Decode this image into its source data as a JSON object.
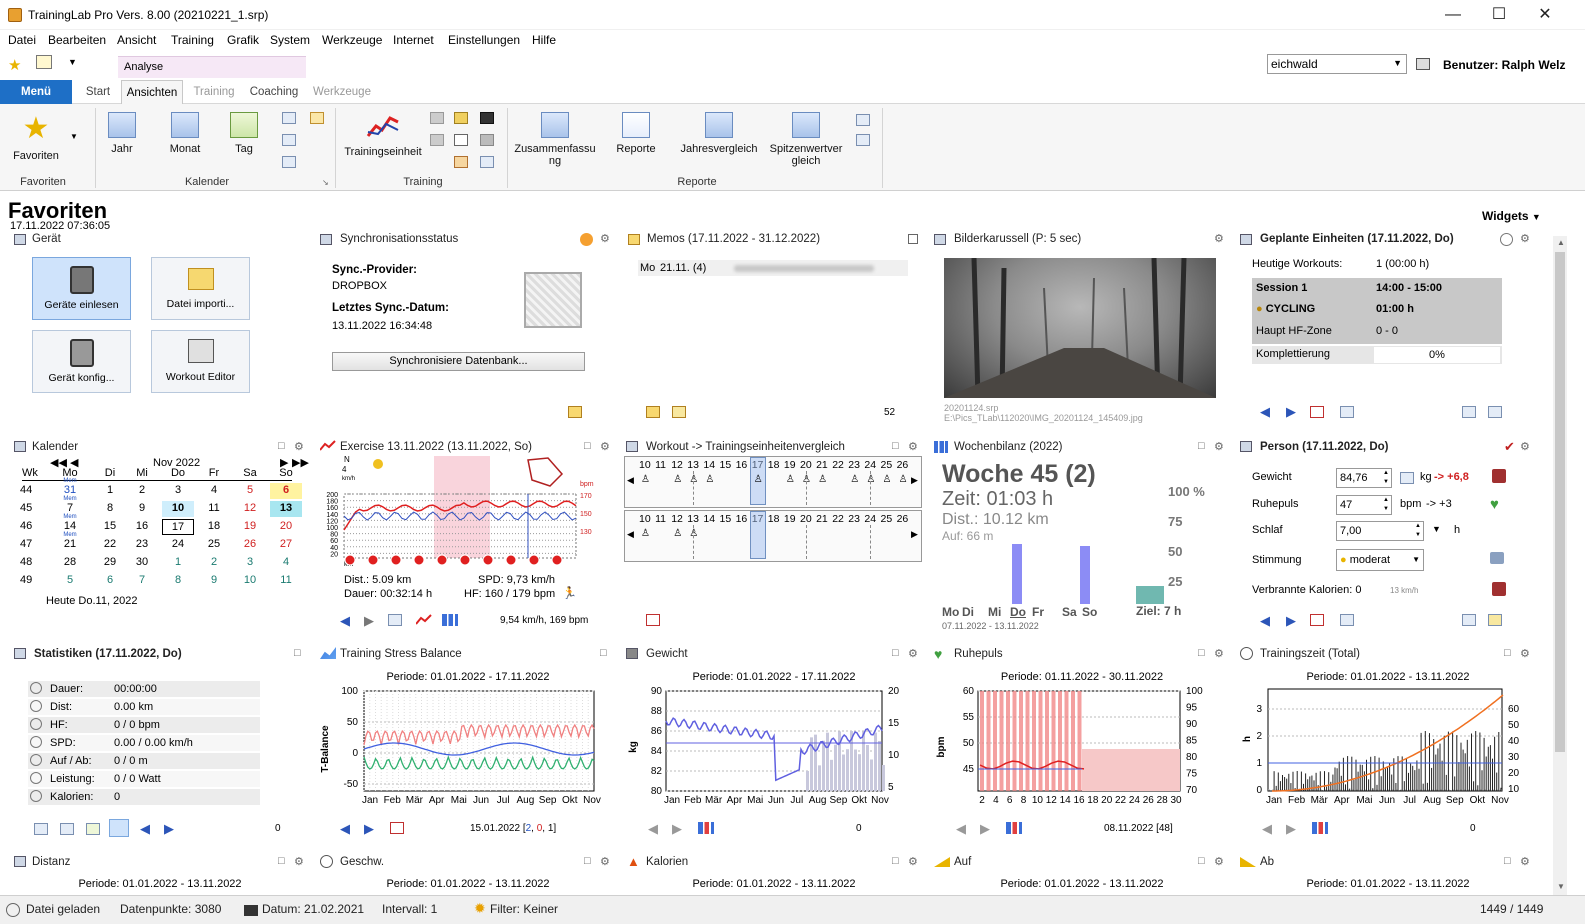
{
  "window": {
    "title": "TrainingLab Pro Vers. 8.00 (20210221_1.srp)"
  },
  "menu": [
    "Datei",
    "Bearbeiten",
    "Ansicht",
    "Training",
    "Grafik",
    "System",
    "Werkzeuge",
    "Internet",
    "Einstellungen",
    "Hilfe"
  ],
  "context_tab": "Analyse",
  "user_select": "eichwald",
  "user_label": "Benutzer: Ralph Welz",
  "tabs": {
    "menu": "Menü",
    "start": "Start",
    "ansichten": "Ansichten",
    "training": "Training",
    "coaching": "Coaching",
    "werkzeuge": "Werkzeuge"
  },
  "ribbon": {
    "favoriten": "Favoriten",
    "jahr": "Jahr",
    "monat": "Monat",
    "tag": "Tag",
    "trainingseinheit": "Trainingseinheit",
    "zusammenfassung": "Zusammenfassu ng",
    "reporte": "Reporte",
    "jahresvergleich": "Jahresvergleich",
    "spitzenwertvergleich": "Spitzenwertver gleich",
    "grp_favoriten": "Favoriten",
    "grp_kalender": "Kalender",
    "grp_training": "Training",
    "grp_reporte": "Reporte"
  },
  "page": {
    "title": "Favoriten",
    "datetime": "17.11.2022 07:36:05",
    "widgets": "Widgets"
  },
  "geraet": {
    "title": "Gerät",
    "b1": "Geräte einlesen",
    "b2": "Datei importi...",
    "b3": "Gerät konfig...",
    "b4": "Workout Editor"
  },
  "sync": {
    "title": "Synchronisationsstatus",
    "provider_label": "Sync.-Provider:",
    "provider": "DROPBOX",
    "last_label": "Letztes Sync.-Datum:",
    "last": "13.11.2022 16:34:48",
    "button": "Synchronisiere Datenbank..."
  },
  "memos": {
    "title": "Memos (17.11.2022 - 31.12.2022)",
    "row_day": "Mo",
    "row_date": "21.11. (4)",
    "count": "52"
  },
  "bilder": {
    "title": "Bilderkarussell (P: 5 sec)",
    "caption1": "20201124.srp",
    "caption2": "E:\\Pics_TLab\\112020\\IMG_20201124_145409.jpg"
  },
  "geplant": {
    "title": "Geplante Einheiten (17.11.2022, Do)",
    "heutige_label": "Heutige Workouts:",
    "heutige": "1 (00:00 h)",
    "session": "Session 1",
    "session_time": "14:00 - 15:00",
    "sport": "CYCLING",
    "dur": "01:00 h",
    "zone_label": "Haupt HF-Zone",
    "zone": "0 - 0",
    "kompl_label": "Komplettierung",
    "kompl": "0%"
  },
  "kalender": {
    "title": "Kalender",
    "month": "Nov 2022",
    "wk": "Wk",
    "days": [
      "Mo",
      "Di",
      "Mi",
      "Do",
      "Fr",
      "Sa",
      "So"
    ],
    "rows": [
      [
        "44",
        "31",
        "1",
        "2",
        "3",
        "4",
        "5",
        "6"
      ],
      [
        "45",
        "7",
        "8",
        "9",
        "10",
        "11",
        "12",
        "13"
      ],
      [
        "46",
        "14",
        "15",
        "16",
        "17",
        "18",
        "19",
        "20"
      ],
      [
        "47",
        "21",
        "22",
        "23",
        "24",
        "25",
        "26",
        "27"
      ],
      [
        "48",
        "28",
        "29",
        "30",
        "1",
        "2",
        "3",
        "4"
      ],
      [
        "49",
        "5",
        "6",
        "7",
        "8",
        "9",
        "10",
        "11"
      ]
    ],
    "today": "Heute Do.11, 2022",
    "mem": "Mem"
  },
  "exercise": {
    "title": "Exercise 13.11.2022 (13.11.2022, So)",
    "dist": "Dist.: 5.09 km",
    "spd": "SPD: 9,73 km/h",
    "dauer": "Dauer: 00:32:14 h",
    "hf": "HF: 160 / 179 bpm",
    "foot": "9,54 km/h, 169 bpm",
    "yticks": [
      "200",
      "180",
      "160",
      "140",
      "120",
      "100",
      "80",
      "60",
      "40",
      "20"
    ],
    "r170": "170",
    "r150": "150",
    "r130": "130",
    "bpm": "bpm",
    "n": "N",
    "kmh": "4",
    "kmhunit": "km/h",
    "km": "km"
  },
  "workout": {
    "title": "Workout -> Trainingseinheitenvergleich",
    "nums": [
      "10",
      "11",
      "12",
      "13",
      "14",
      "15",
      "16",
      "17",
      "18",
      "19",
      "20",
      "21",
      "22",
      "23",
      "24",
      "25",
      "26"
    ]
  },
  "wochen": {
    "title": "Wochenbilanz (2022)",
    "woche": "Woche 45 (2)",
    "zeit": "Zeit: 01:03 h",
    "dist": "Dist.: 10.12 km",
    "auf": "Auf: 66 m",
    "pct": [
      "100 %",
      "75",
      "50",
      "25"
    ],
    "days": [
      "Mo",
      "Di",
      "Mi",
      "Do",
      "Fr",
      "Sa",
      "So"
    ],
    "ziel": "Ziel: 7 h",
    "range": "07.11.2022 - 13.11.2022"
  },
  "person": {
    "title": "Person (17.11.2022, Do)",
    "gewicht_label": "Gewicht",
    "gewicht": "84,76",
    "gewicht_unit": "kg",
    "gewicht_delta": "-> +6,8",
    "ruhe_label": "Ruhepuls",
    "ruhe": "47",
    "ruhe_unit": "bpm",
    "ruhe_delta": "-> +3",
    "schlaf_label": "Schlaf",
    "schlaf": "7,00",
    "schlaf_unit": "h",
    "stimmung_label": "Stimmung",
    "stimmung": "moderat",
    "kal_label": "Verbrannte Kalorien: 0",
    "kal_unit": "13 km/h"
  },
  "stats": {
    "title": "Statistiken (17.11.2022, Do)",
    "rows": [
      [
        "Dauer:",
        "00:00:00"
      ],
      [
        "Dist:",
        "0.00 km"
      ],
      [
        "HF:",
        "0 / 0 bpm"
      ],
      [
        "SPD:",
        "0.00 / 0.00 km/h"
      ],
      [
        "Auf / Ab:",
        "0 / 0 m"
      ],
      [
        "Leistung:",
        "0 / 0 Watt"
      ],
      [
        "Kalorien:",
        "0"
      ]
    ],
    "count": "0"
  },
  "tsb": {
    "title": "Training Stress Balance",
    "period": "Periode: 01.01.2022 - 17.11.2022",
    "ylabel": "T-Balance",
    "yticks": [
      "100",
      "50",
      "0",
      "-50"
    ],
    "months": [
      "Jan",
      "Feb",
      "Mär",
      "Apr",
      "Mai",
      "Jun",
      "Jul",
      "Aug",
      "Sep",
      "Okt",
      "Nov"
    ],
    "foot": "15.01.2022 [2, 0, 1]",
    "foot_a": "15.01.2022 [",
    "foot_b": "2",
    "foot_c": "0",
    "foot_d": "1",
    "foot_e": "]"
  },
  "gewicht": {
    "title": "Gewicht",
    "period": "Periode: 01.01.2022 - 17.11.2022",
    "ylabel": "kg",
    "yticks": [
      "90",
      "88",
      "86",
      "84",
      "82",
      "80"
    ],
    "y2": [
      "20",
      "15",
      "10",
      "5"
    ],
    "months": [
      "Jan",
      "Feb",
      "Mär",
      "Apr",
      "Mai",
      "Jun",
      "Jul",
      "Aug",
      "Sep",
      "Okt",
      "Nov"
    ],
    "count": "0"
  },
  "ruhepuls": {
    "title": "Ruhepuls",
    "period": "Periode: 01.11.2022 - 30.11.2022",
    "ylabel": "bpm",
    "yticks": [
      "60",
      "55",
      "50",
      "45"
    ],
    "y2": [
      "100",
      "95",
      "90",
      "85",
      "80",
      "75",
      "70"
    ],
    "xticks": [
      "2",
      "4",
      "6",
      "8",
      "10",
      "12",
      "14",
      "16",
      "18",
      "20",
      "22",
      "24",
      "26",
      "28",
      "30"
    ],
    "foot": "08.11.2022 [48]"
  },
  "tzeit": {
    "title": "Trainingszeit (Total)",
    "period": "Periode: 01.01.2022 - 13.11.2022",
    "ylabel": "h",
    "yticks": [
      "3",
      "2",
      "1",
      "0"
    ],
    "y2": [
      "60",
      "50",
      "40",
      "30",
      "20",
      "10"
    ],
    "months": [
      "Jan",
      "Feb",
      "Mär",
      "Apr",
      "Mai",
      "Jun",
      "Jul",
      "Aug",
      "Sep",
      "Okt",
      "Nov"
    ],
    "count": "0"
  },
  "bottom": {
    "distanz": "Distanz",
    "geschw": "Geschw.",
    "kalorien": "Kalorien",
    "auf": "Auf",
    "ab": "Ab",
    "period": "Periode: 01.01.2022 - 13.11.2022"
  },
  "status": {
    "s1": "Datei geladen",
    "s2": "Datenpunkte: 3080",
    "s3": "Datum: 21.02.2021",
    "s4": "Intervall: 1",
    "s5": "Filter: Keiner",
    "s6": "1449 / 1449"
  }
}
